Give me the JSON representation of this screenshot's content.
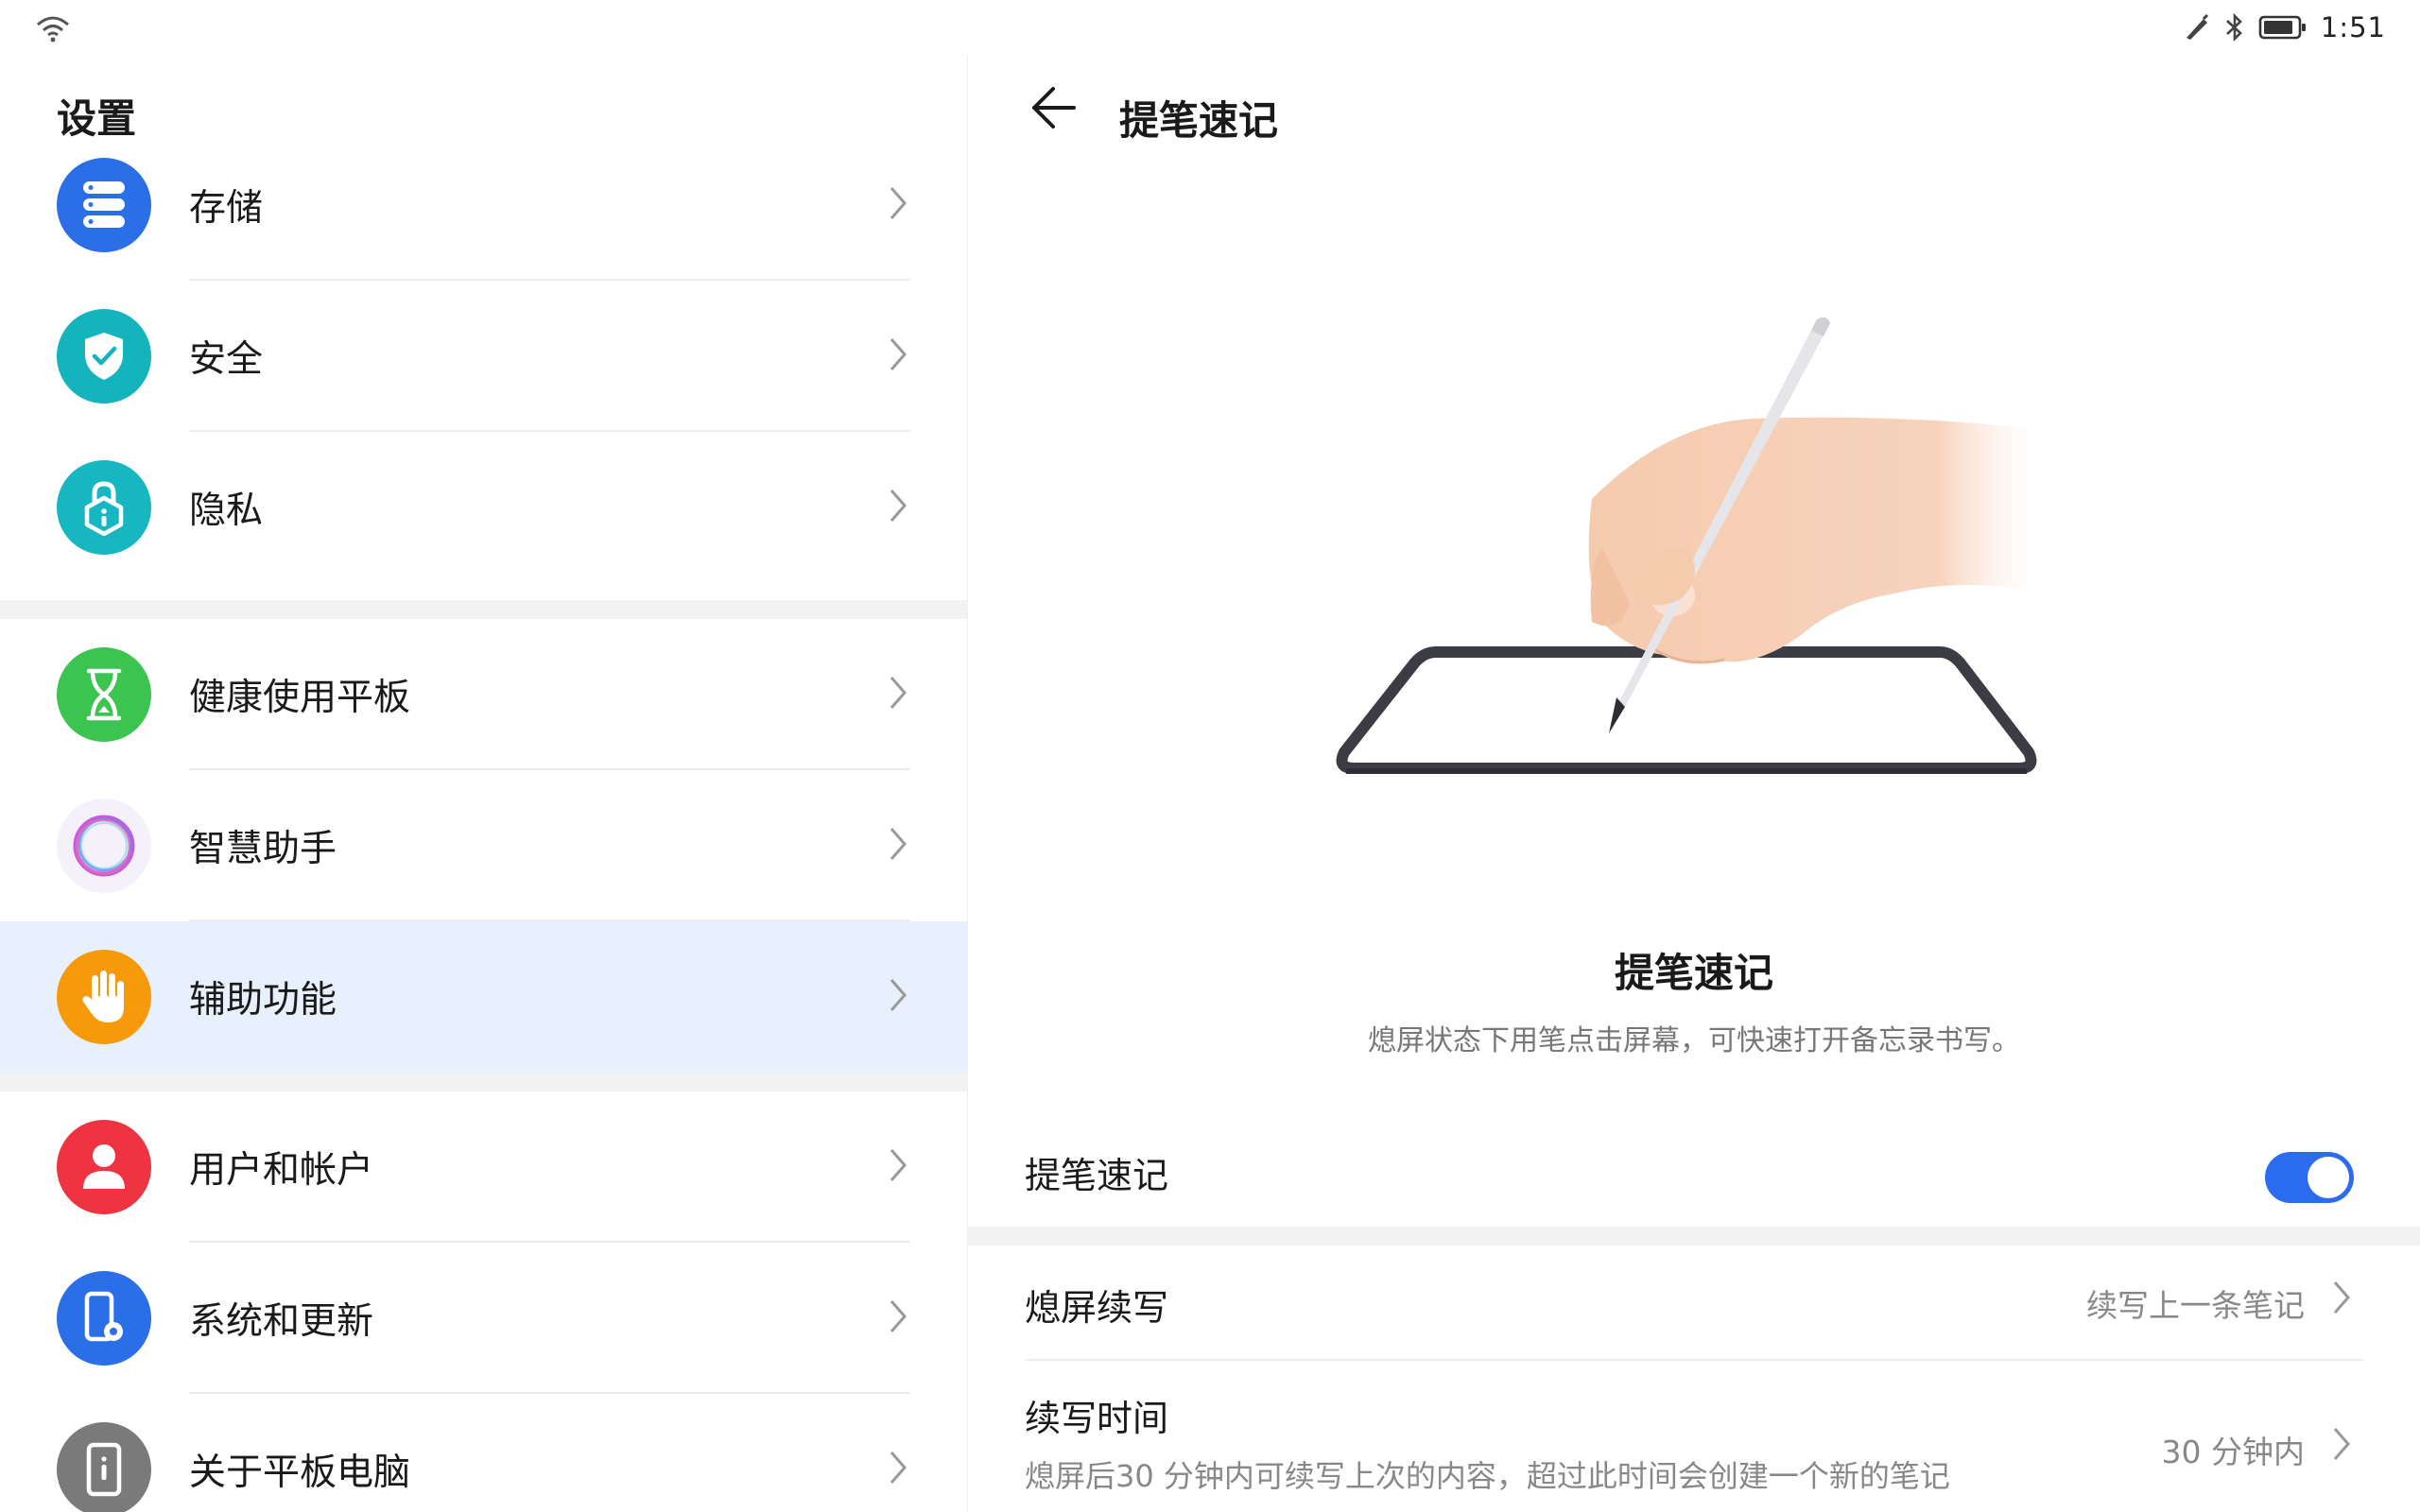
{
  "status_bar": {
    "time": "1:51",
    "icons": [
      "wifi-icon",
      "stylus-icon",
      "bluetooth-icon",
      "battery-icon"
    ]
  },
  "settings": {
    "title": "设置",
    "items": [
      {
        "label": "存储",
        "icon": "storage-icon",
        "color": "#2a6fe8"
      },
      {
        "label": "安全",
        "icon": "shield-icon",
        "color": "#14b4bd"
      },
      {
        "label": "隐私",
        "icon": "privacy-lock-icon",
        "color": "#17b7c2"
      },
      {
        "label": "健康使用平板",
        "icon": "hourglass-icon",
        "color": "#3cc451"
      },
      {
        "label": "智慧助手",
        "icon": "assistant-ring-icon",
        "color": "#f4f1fb"
      },
      {
        "label": "辅助功能",
        "icon": "hand-icon",
        "color": "#f79a0a"
      },
      {
        "label": "用户和帐户",
        "icon": "user-icon",
        "color": "#ef3340"
      },
      {
        "label": "系统和更新",
        "icon": "system-update-icon",
        "color": "#2a6fe8"
      },
      {
        "label": "关于平板电脑",
        "icon": "tablet-info-icon",
        "color": "#7a7a7a"
      }
    ],
    "active_index": 5
  },
  "detail": {
    "title": "提笔速记",
    "feature_title": "提笔速记",
    "feature_description": "熄屏状态下用笔点击屏幕，可快速打开备忘录书写。",
    "toggle_row": {
      "label": "提笔速记",
      "enabled": true
    },
    "continue_row": {
      "label": "熄屏续写",
      "value": "续写上一条笔记"
    },
    "time_row": {
      "label": "续写时间",
      "description": "熄屏后30 分钟内可续写上次的内容，超过此时间会创建一个新的笔记",
      "value": "30 分钟内"
    }
  },
  "colors": {
    "accent": "#2b6bf0",
    "active_row_bg": "#e8f0fd"
  }
}
